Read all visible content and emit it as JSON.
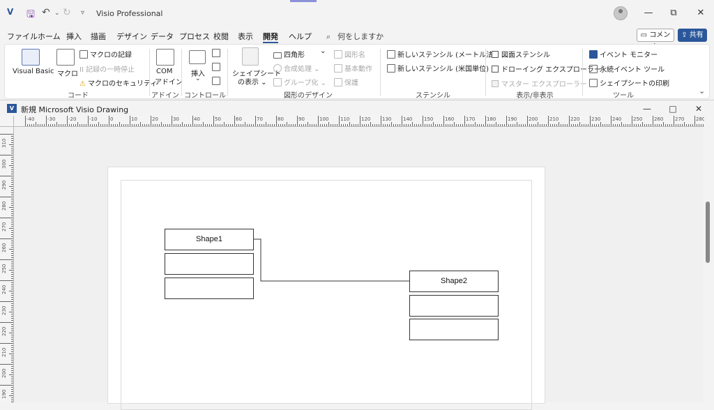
{
  "titlebar": {
    "app_title": "Visio Professional",
    "qa_save_icon": "save-icon",
    "qa_undo_icon": "undo-icon",
    "qa_redo_icon": "redo-icon"
  },
  "menu": {
    "tabs": [
      "ファイル",
      "ホーム",
      "挿入",
      "描画",
      "デザイン",
      "データ",
      "プロセス",
      "校閲",
      "表示",
      "開発",
      "ヘルプ"
    ],
    "active_tab": "開発",
    "search_placeholder": "何をしますか",
    "comment_label": "コメント",
    "share_label": "共有"
  },
  "ribbon": {
    "code": {
      "label": "コード",
      "visual_basic": "Visual Basic",
      "macro": "マクロ",
      "record_macro": "マクロの記録",
      "pause_recording": "II 記録の一時停止",
      "macro_security": "マクロのセキュリティ"
    },
    "addin": {
      "label": "アドイン",
      "com_line1": "COM",
      "com_line2": "アドイン"
    },
    "controls": {
      "label": "コントロール",
      "insert": "挿入"
    },
    "shape_design": {
      "label": "図形のデザイン",
      "show_shapesheet_line1": "シェイプシート",
      "show_shapesheet_line2": "の表示",
      "rectangle": "四角形",
      "operations": "合成処理",
      "group": "グループ化",
      "shape_name": "図形名",
      "behavior": "基本動作",
      "protection": "保護"
    },
    "stencil": {
      "label": "ステンシル",
      "new_metric": "新しいステンシル (メートル法)",
      "new_us": "新しいステンシル (米国単位)"
    },
    "show_hide": {
      "label": "表示/非表示",
      "document_stencil": "図面ステンシル",
      "drawing_explorer": "ドローイング エクスプローラー",
      "master_explorer": "マスター エクスプローラー"
    },
    "tools": {
      "label": "ツール",
      "event_monitor": "イベント モニター",
      "persistent_events": "永続イベント ツール",
      "print_shapesheet": "シェイプシートの印刷"
    }
  },
  "document": {
    "title": "新規 Microsoft Visio Drawing",
    "hruler_labels": [
      "-40",
      "-30",
      "-20",
      "-10",
      "0",
      "10",
      "20",
      "30",
      "40",
      "50",
      "60",
      "70",
      "80",
      "90",
      "100",
      "110",
      "120",
      "130",
      "140",
      "150",
      "160",
      "170",
      "180",
      "190",
      "200",
      "210",
      "220",
      "230",
      "240",
      "250",
      "260",
      "270",
      "280"
    ],
    "vruler_labels": [
      "310",
      "300",
      "290",
      "280",
      "270",
      "260",
      "250",
      "240",
      "230",
      "220",
      "210",
      "200",
      "190"
    ],
    "shapes": {
      "shape1_label": "Shape1",
      "shape2_label": "Shape2"
    }
  }
}
